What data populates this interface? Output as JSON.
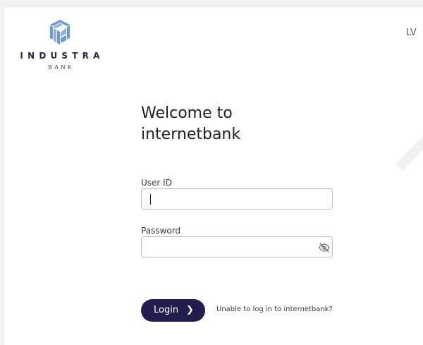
{
  "brand": {
    "name": "INDUSTRA",
    "sub": "BANK",
    "logo_icon": "industra-cube-logo",
    "accent_color": "#6b9bd1"
  },
  "header": {
    "language": "LV"
  },
  "login": {
    "title": "Welcome to internetbank",
    "user_id_label": "User ID",
    "user_id_value": "",
    "password_label": "Password",
    "password_value": "",
    "password_toggle_icon": "eye-slash-icon",
    "submit_label": "Login",
    "submit_icon": "chevron-right-icon",
    "submit_color": "#221d4f",
    "help_link": "Unable to log in to internetbank?"
  }
}
